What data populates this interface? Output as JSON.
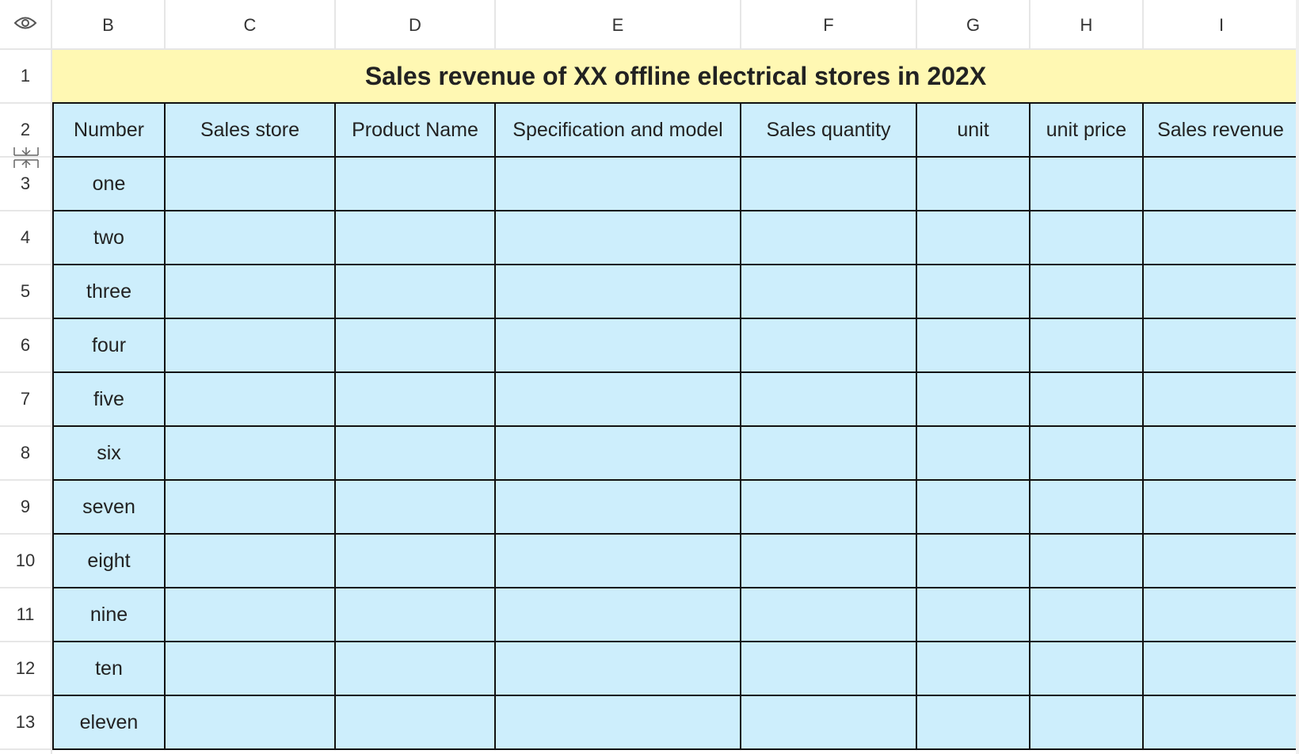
{
  "icons": {
    "corner": "eye-icon",
    "row_resize": "row-resize-icon"
  },
  "columns": [
    "B",
    "C",
    "D",
    "E",
    "F",
    "G",
    "H",
    "I"
  ],
  "rows": [
    "1",
    "2",
    "3",
    "4",
    "5",
    "6",
    "7",
    "8",
    "9",
    "10",
    "11",
    "12",
    "13"
  ],
  "title": "Sales revenue of XX offline electrical stores in 202X",
  "headers": [
    "Number",
    "Sales store",
    "Product Name",
    "Specification and model",
    "Sales quantity",
    "unit",
    "unit price",
    "Sales revenue"
  ],
  "numbers": [
    "one",
    "two",
    "three",
    "four",
    "five",
    "six",
    "seven",
    "eight",
    "nine",
    "ten",
    "eleven"
  ],
  "colors": {
    "title_fill": "#fff8b3",
    "cell_fill": "#cdeefc",
    "border": "#111111"
  }
}
